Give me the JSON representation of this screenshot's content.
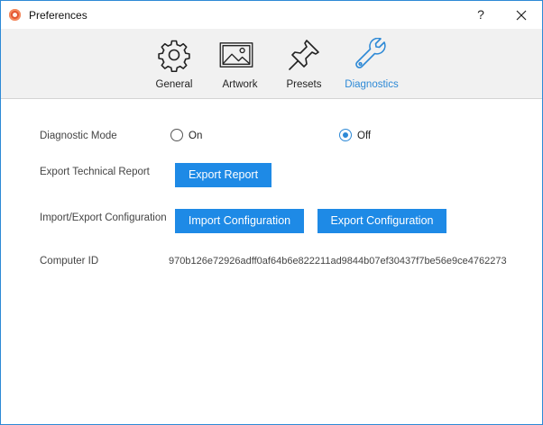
{
  "window": {
    "title": "Preferences",
    "help_label": "?"
  },
  "tabs": [
    {
      "label": "General",
      "icon": "gear-icon"
    },
    {
      "label": "Artwork",
      "icon": "image-icon"
    },
    {
      "label": "Presets",
      "icon": "pushpin-icon"
    },
    {
      "label": "Diagnostics",
      "icon": "wrench-icon"
    }
  ],
  "active_tab": "Diagnostics",
  "diagnostic_mode": {
    "label": "Diagnostic Mode",
    "options": [
      "On",
      "Off"
    ],
    "selected": "Off"
  },
  "export_report": {
    "label": "Export Technical Report",
    "button": "Export Report"
  },
  "configuration": {
    "label": "Import/Export Configuration",
    "import_button": "Import Configuration",
    "export_button": "Export Configuration"
  },
  "computer_id": {
    "label": "Computer ID",
    "value": "970b126e72926adff0af64b6e822211ad9844b07ef30437f7be56e9ce4762273"
  },
  "colors": {
    "accent": "#1e8ae6",
    "border": "#2d89d6",
    "toolbar_bg": "#f1f1f1"
  }
}
